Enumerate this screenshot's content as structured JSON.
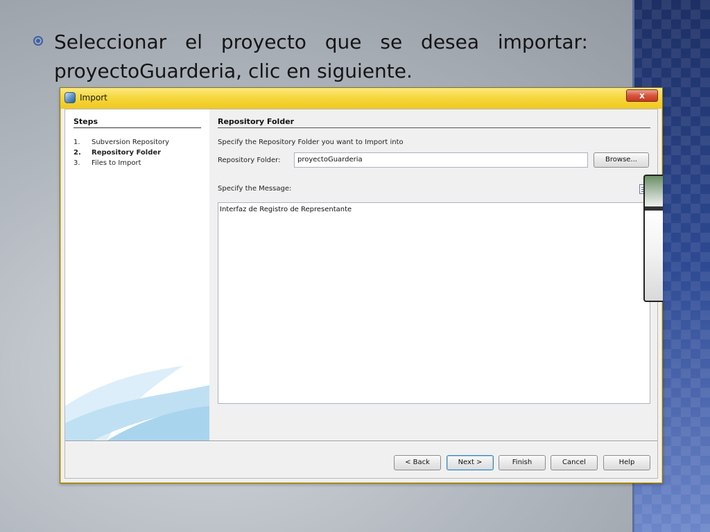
{
  "slide": {
    "bullet_line1_words": [
      "Seleccionar",
      "el",
      "proyecto",
      "que",
      "se",
      "desea",
      "importar:"
    ],
    "bullet_line2": "proyectoGuarderia, clic en siguiente."
  },
  "dialog": {
    "title": "Import",
    "close_label": "x",
    "steps": {
      "title": "Steps",
      "items": [
        {
          "num": "1.",
          "label": "Subversion Repository",
          "active": false
        },
        {
          "num": "2.",
          "label": "Repository Folder",
          "active": true
        },
        {
          "num": "3.",
          "label": "Files to Import",
          "active": false
        }
      ]
    },
    "section_title": "Repository Folder",
    "instruction": "Specify the Repository Folder you want to Import into",
    "folder_label": "Repository Folder:",
    "folder_value": "proyectoGuarderia",
    "browse_label": "Browse...",
    "message_label": "Specify the Message:",
    "message_value": "Interfaz de Registro de Representante",
    "buttons": {
      "back": "< Back",
      "next": "Next >",
      "finish": "Finish",
      "cancel": "Cancel",
      "help": "Help"
    }
  },
  "colors": {
    "titlebar": "#f5d63a",
    "deco_stripe": "#2e4a93",
    "bullet": "#3e5fa8"
  },
  "icons": [
    "radio-bullet-icon",
    "netbeans-app-icon",
    "close-icon",
    "message-template-icon"
  ]
}
